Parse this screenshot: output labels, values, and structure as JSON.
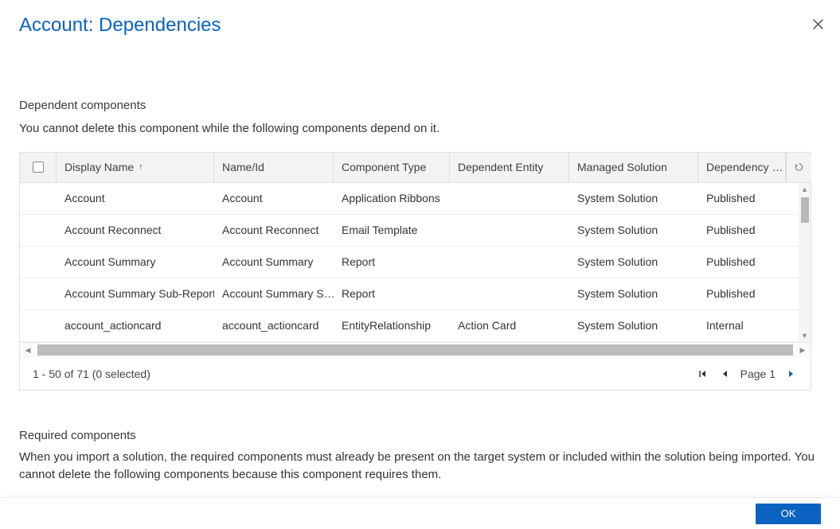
{
  "dialog": {
    "title": "Account: Dependencies",
    "ok_label": "OK"
  },
  "dependent": {
    "heading": "Dependent components",
    "text": "You cannot delete this component while the following components depend on it."
  },
  "required": {
    "heading": "Required components",
    "text": "When you import a solution, the required components must already be present on the target system or included within the solution being imported. You cannot delete the following components because this component requires them."
  },
  "grid": {
    "columns": {
      "display_name": "Display Name",
      "name_id": "Name/Id",
      "component_type": "Component Type",
      "dependent_entity": "Dependent Entity",
      "managed_solution": "Managed Solution",
      "dependency": "Dependency …"
    },
    "sort_indicator": "↑",
    "rows": [
      {
        "display": "Account",
        "name": "Account",
        "type": "Application Ribbons",
        "entity": "",
        "solution": "System Solution",
        "dep": "Published"
      },
      {
        "display": "Account Reconnect",
        "name": "Account Reconnect",
        "type": "Email Template",
        "entity": "",
        "solution": "System Solution",
        "dep": "Published"
      },
      {
        "display": "Account Summary",
        "name": "Account Summary",
        "type": "Report",
        "entity": "",
        "solution": "System Solution",
        "dep": "Published"
      },
      {
        "display": "Account Summary Sub-Report",
        "name": "Account Summary S…",
        "type": "Report",
        "entity": "",
        "solution": "System Solution",
        "dep": "Published"
      },
      {
        "display": "account_actioncard",
        "name": "account_actioncard",
        "type": "EntityRelationship",
        "entity": "Action Card",
        "solution": "System Solution",
        "dep": "Internal"
      }
    ],
    "footer": {
      "status": "1 - 50 of 71 (0 selected)",
      "page_label": "Page 1"
    }
  }
}
